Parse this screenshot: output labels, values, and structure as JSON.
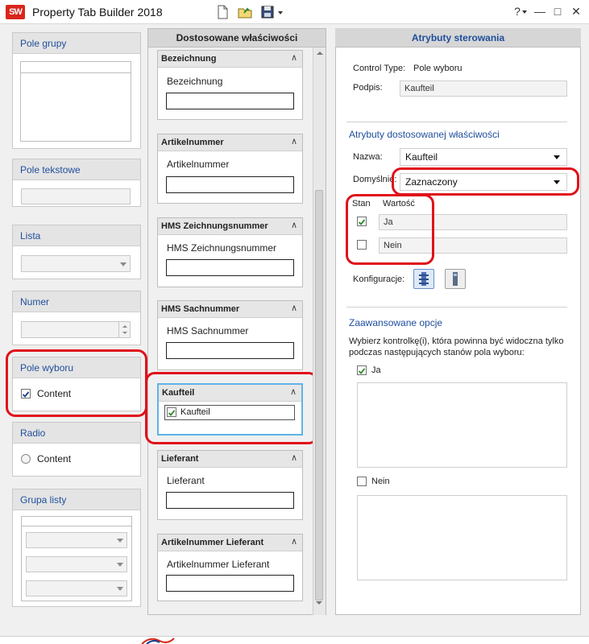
{
  "window": {
    "title": "Property Tab Builder  2018",
    "logo_text": "SW",
    "help_label": "?",
    "minimize": "—",
    "maximize": "□",
    "close": "✕"
  },
  "palette": {
    "group_box": {
      "title": "Pole grupy"
    },
    "text_field": {
      "title": "Pole tekstowe"
    },
    "list": {
      "title": "Lista"
    },
    "number": {
      "title": "Numer"
    },
    "checkbox": {
      "title": "Pole wyboru",
      "item_label": "Content",
      "checked": true
    },
    "radio": {
      "title": "Radio",
      "item_label": "Content"
    },
    "list_group": {
      "title": "Grupa listy"
    }
  },
  "middle": {
    "title": "Dostosowane właściwości",
    "cards": [
      {
        "header": "Bezeichnung",
        "label": "Bezeichnung"
      },
      {
        "header": "Artikelnummer",
        "label": "Artikelnummer"
      },
      {
        "header": "HMS Zeichnungsnummer",
        "label": "HMS Zeichnungsnummer"
      },
      {
        "header": "HMS Sachnummer",
        "label": "HMS Sachnummer"
      },
      {
        "header": "Kaufteil",
        "label": "Kaufteil",
        "checked": true
      },
      {
        "header": "Lieferant",
        "label": "Lieferant"
      },
      {
        "header": "Artikelnummer Lieferant",
        "label": "Artikelnummer Lieferant"
      }
    ],
    "collapse_glyph": "∧"
  },
  "right": {
    "title": "Atrybuty sterowania",
    "control_type_label": "Control Type:",
    "control_type_value": "Pole wyboru",
    "caption_label": "Podpis:",
    "caption_value": "Kaufteil",
    "custom_section": "Atrybuty dostosowanej właściwości",
    "name_label": "Nazwa:",
    "name_value": "Kaufteil",
    "default_label": "Domyślnie:",
    "default_value": "Zaznaczony",
    "state_header": "Stan",
    "value_header": "Wartość",
    "states": [
      {
        "checked": true,
        "value": "Ja"
      },
      {
        "checked": false,
        "value": "Nein"
      }
    ],
    "config_label": "Konfiguracje:",
    "advanced_section": "Zaawansowane opcje",
    "advanced_desc": "Wybierz kontrolkę(i), która powinna być widoczna tylko podczas następujących stanów pola wyboru:",
    "adv_ja": {
      "label": "Ja",
      "checked": true
    },
    "adv_nein": {
      "label": "Nein",
      "checked": false
    }
  },
  "colors": {
    "accent": "#1f4e9c",
    "highlight": "#e0101a",
    "check": "#2e8b2e"
  }
}
